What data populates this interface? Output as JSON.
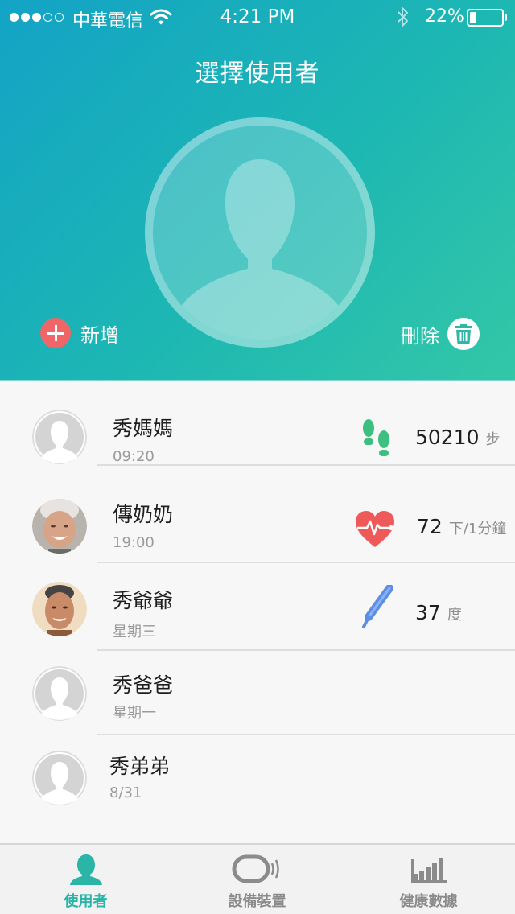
{
  "status_bar": {
    "carrier": "中華電信",
    "time": "4:21 PM",
    "battery_percent": "22%",
    "battery_level": 0.22,
    "signal_bars": 3,
    "icons": [
      "wifi-icon",
      "bluetooth-icon",
      "battery-icon"
    ]
  },
  "header": {
    "title": "選擇使用者",
    "add_label": "新增",
    "delete_label": "刪除",
    "colors": {
      "gradient_start": "#13a3c6",
      "gradient_end": "#33c7a7",
      "add_button": "#f06565"
    }
  },
  "users": [
    {
      "name": "秀媽媽",
      "sub": "09:20",
      "avatar": "placeholder",
      "metric_icon": "footprints-icon",
      "metric_value": "50210",
      "metric_unit": "步"
    },
    {
      "name": "傳奶奶",
      "sub": "19:00",
      "avatar": "photo-grandma",
      "metric_icon": "heart-rate-icon",
      "metric_value": "72",
      "metric_unit": "下/1分鐘"
    },
    {
      "name": "秀爺爺",
      "sub": "星期三",
      "avatar": "photo-grandpa",
      "metric_icon": "thermometer-icon",
      "metric_value": "37",
      "metric_unit": "度"
    },
    {
      "name": "秀爸爸",
      "sub": "星期一",
      "avatar": "placeholder"
    },
    {
      "name": "秀弟弟",
      "sub": "8/31",
      "avatar": "placeholder"
    }
  ],
  "tabs": [
    {
      "label": "使用者",
      "icon": "user-icon",
      "active": true
    },
    {
      "label": "設備裝置",
      "icon": "device-icon",
      "active": false
    },
    {
      "label": "健康數據",
      "icon": "bar-chart-icon",
      "active": false
    }
  ],
  "colors": {
    "accent": "#2bb5a6",
    "metric_green": "#3dbf7f",
    "heart_red": "#ee5a5a",
    "thermo_blue": "#5b8ee6"
  }
}
